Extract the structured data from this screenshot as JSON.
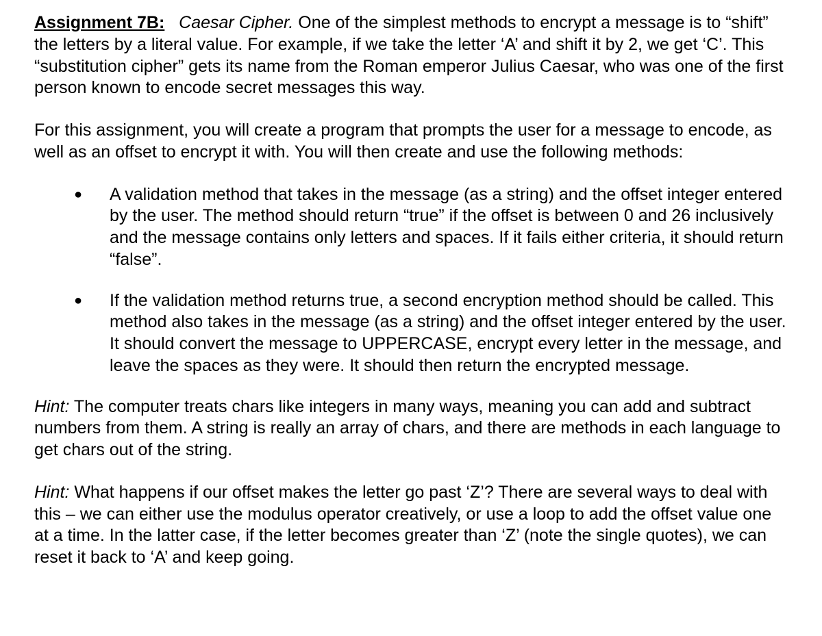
{
  "title": {
    "label": "Assignment 7B:",
    "subtitle": "Caesar Cipher.",
    "intro_rest": " One of the simplest methods to encrypt a message is to “shift” the letters by a literal value. For example, if we take the letter ‘A’ and shift it by 2, we get ‘C’. This “substitution cipher” gets its name from the Roman emperor Julius Caesar, who was one of the first person known to encode secret messages this way."
  },
  "instructions_para": "For this assignment, you will create a program that prompts the user for a message to encode, as well as an offset to encrypt it with. You will then create and use the following methods:",
  "bullets": [
    "A validation method that takes in the message (as a string) and the offset integer entered by the user. The method should return “true” if the offset is between 0 and 26 inclusively and the message contains only letters and spaces. If it fails either criteria, it should return “false”.",
    "If the validation method returns true, a second encryption method should be called. This method also takes in the message (as a string) and the offset integer entered by the user. It should convert the message to UPPERCASE, encrypt every letter in the message, and leave the spaces as they were. It should then return the encrypted message."
  ],
  "hints": [
    {
      "label": "Hint:",
      "text": " The computer treats chars like integers in many ways, meaning you can add and subtract numbers from them. A string is really an array of chars, and there are methods in each language to get chars out of the string."
    },
    {
      "label": "Hint:",
      "text": " What happens if our offset makes the letter go past ‘Z’? There are several ways to deal with this – we can either use the modulus operator creatively, or use a loop to add the offset value one at a time. In the latter case, if the letter becomes greater than ‘Z’ (note the single quotes), we can reset it back to ‘A’ and keep going."
    }
  ]
}
